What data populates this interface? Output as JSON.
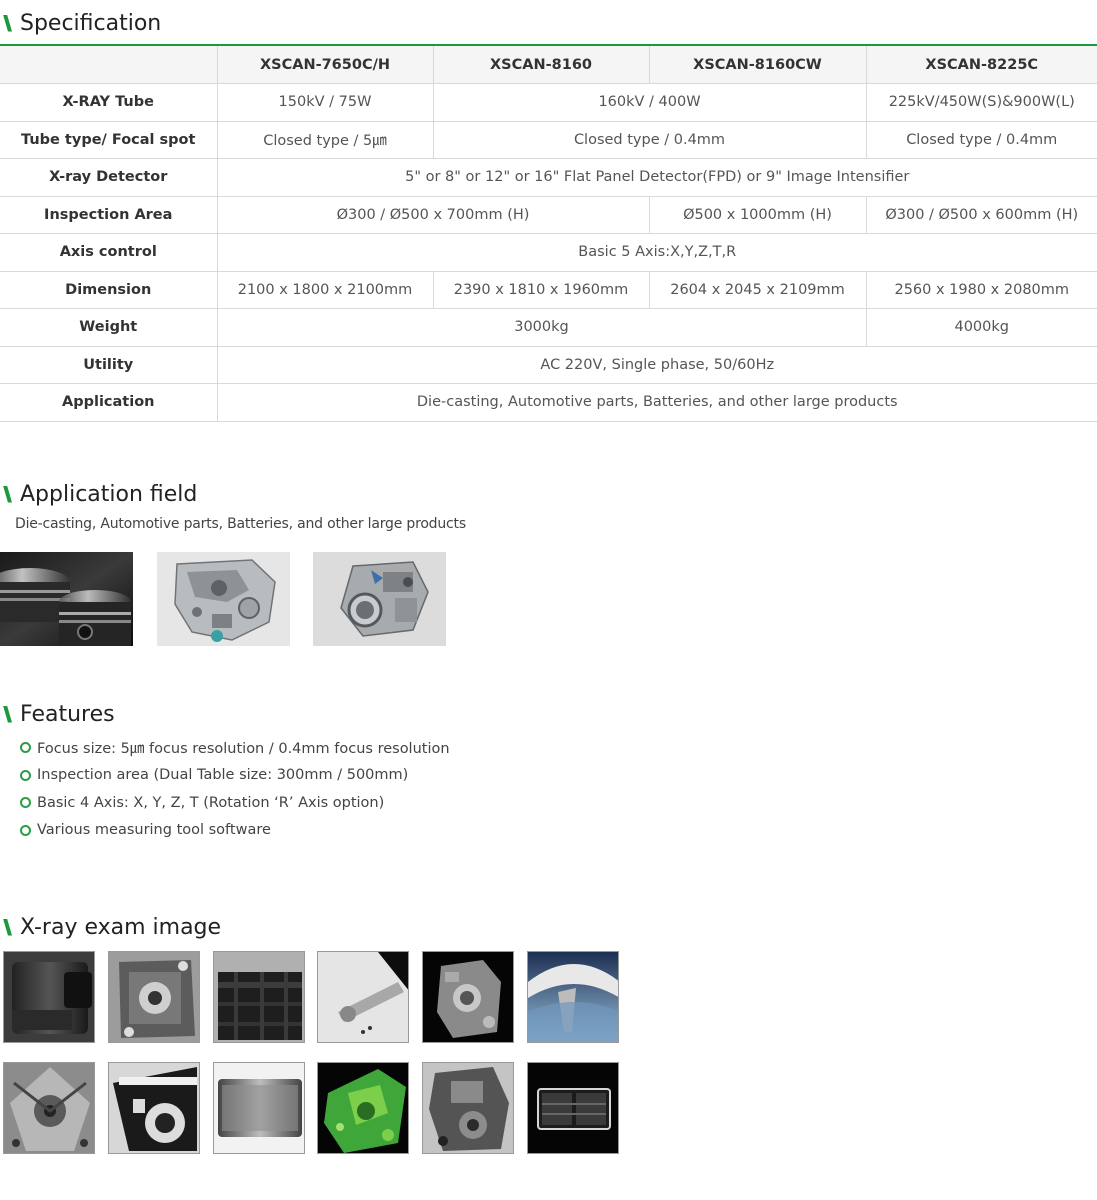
{
  "spec": {
    "title": "Specification",
    "header": [
      "",
      "XSCAN-7650C/H",
      "XSCAN-8160",
      "XSCAN-8160CW",
      "XSCAN-8225C"
    ],
    "rows": {
      "tube": {
        "label": "X-RAY Tube",
        "c1": "150kV / 75W",
        "c2": "160kV / 400W",
        "c3": "225kV/450W(S)&900W(L)"
      },
      "focal": {
        "label": "Tube type/ Focal spot",
        "c1": "Closed type / 5㎛",
        "c2": "Closed type / 0.4mm",
        "c3": "Closed type / 0.4mm"
      },
      "detector": {
        "label": "X-ray Detector",
        "c1": "5\" or 8\" or 12\" or 16\" Flat Panel Detector(FPD) or 9\" Image Intensifier"
      },
      "area": {
        "label": "Inspection Area",
        "c1": "Ø300 / Ø500 x 700mm (H)",
        "c2": "Ø500 x 1000mm (H)",
        "c3": "Ø300 / Ø500 x 600mm (H)"
      },
      "axis": {
        "label": "Axis control",
        "c1": "Basic 5 Axis:X,Y,Z,T,R"
      },
      "dimension": {
        "label": "Dimension",
        "c1": "2100 x 1800 x 2100mm",
        "c2": "2390 x 1810 x 1960mm",
        "c3": "2604 x 2045 x 2109mm",
        "c4": "2560 x 1980 x 2080mm"
      },
      "weight": {
        "label": "Weight",
        "c1": "3000kg",
        "c2": "4000kg"
      },
      "utility": {
        "label": "Utility",
        "c1": "AC 220V, Single phase, 50/60Hz"
      },
      "application": {
        "label": "Application",
        "c1": "Die-casting, Automotive parts, Batteries, and other large products"
      }
    }
  },
  "application_field": {
    "title": "Application field",
    "description": "Die-casting, Automotive parts, Batteries, and other large products"
  },
  "features": {
    "title": "Features",
    "items": [
      "Focus size: 5㎛ focus resolution / 0.4mm focus resolution",
      "Inspection area (Dual Table size: 300mm / 500mm)",
      "Basic 4 Axis: X, Y, Z, T (Rotation ‘R’ Axis option)",
      "Various measuring tool software"
    ]
  },
  "xray": {
    "title": "X-ray exam image"
  },
  "colors": {
    "accent": "#1a9a3c",
    "border": "#d9d9d9",
    "header_bg": "#f5f5f5"
  }
}
